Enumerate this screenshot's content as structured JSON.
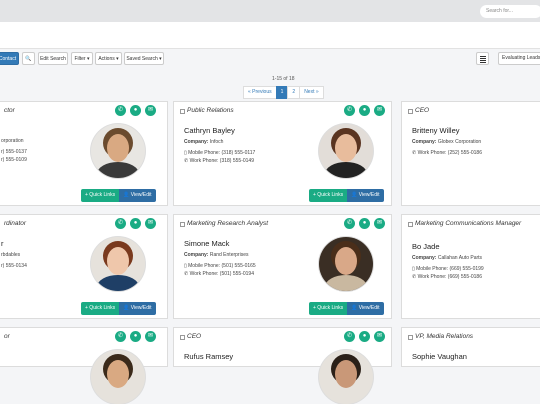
{
  "search": {
    "placeholder": "Search for..."
  },
  "toolbar": {
    "contact": "Contact",
    "edit_search": "Edit Search",
    "filter": "Filter ▾",
    "actions": "Actions ▾",
    "saved_search": "Saved Search ▾",
    "view_select": "Evaluating Leads"
  },
  "pagination": {
    "count": "1-15 of 18",
    "previous": "« Previous",
    "page1": "1",
    "page2": "2",
    "next": "Next »"
  },
  "labels": {
    "company": "Company:",
    "quick_links": "+ Quick Links",
    "view_edit": "👤 View/Edit"
  },
  "cards": [
    {
      "title": "ctor",
      "name": "",
      "company": "orporation",
      "phones": [
        "r) 555-0137",
        "r) 555-0109"
      ]
    },
    {
      "title": "Public Relations",
      "name": "Cathryn Bayley",
      "company": "Infoch",
      "phones": [
        "Mobile Phone: (318) 555-0117",
        "Work Phone: (318) 555-0149"
      ]
    },
    {
      "title": "CEO",
      "name": "Britteny Willey",
      "company": "Globex Corporation",
      "phones": [
        "Work Phone: (252) 555-0186"
      ]
    },
    {
      "title": "rdinator",
      "name": "r",
      "company": "rbdables",
      "phones": [
        "r) 555-0134"
      ]
    },
    {
      "title": "Marketing Research Analyst",
      "name": "Simone Mack",
      "company": "Rand Enterprises",
      "phones": [
        "Mobile Phone: (501) 555-0165",
        "Work Phone: (501) 555-0194"
      ]
    },
    {
      "title": "Marketing Communications Manager",
      "name": "Bo Jade",
      "company": "Callahan Auto Parts",
      "phones": [
        "Mobile Phone: (669) 555-0199",
        "Work Phone: (669) 555-0186"
      ]
    },
    {
      "title": "or",
      "name": "",
      "company": "",
      "phones": []
    },
    {
      "title": "CEO",
      "name": "Rufus Ramsey",
      "company": "",
      "phones": []
    },
    {
      "title": "VP, Media Relations",
      "name": "Sophie Vaughan",
      "company": "",
      "phones": []
    }
  ],
  "colors": {
    "accent_green": "#1aab84",
    "primary_blue": "#2e6da4"
  }
}
